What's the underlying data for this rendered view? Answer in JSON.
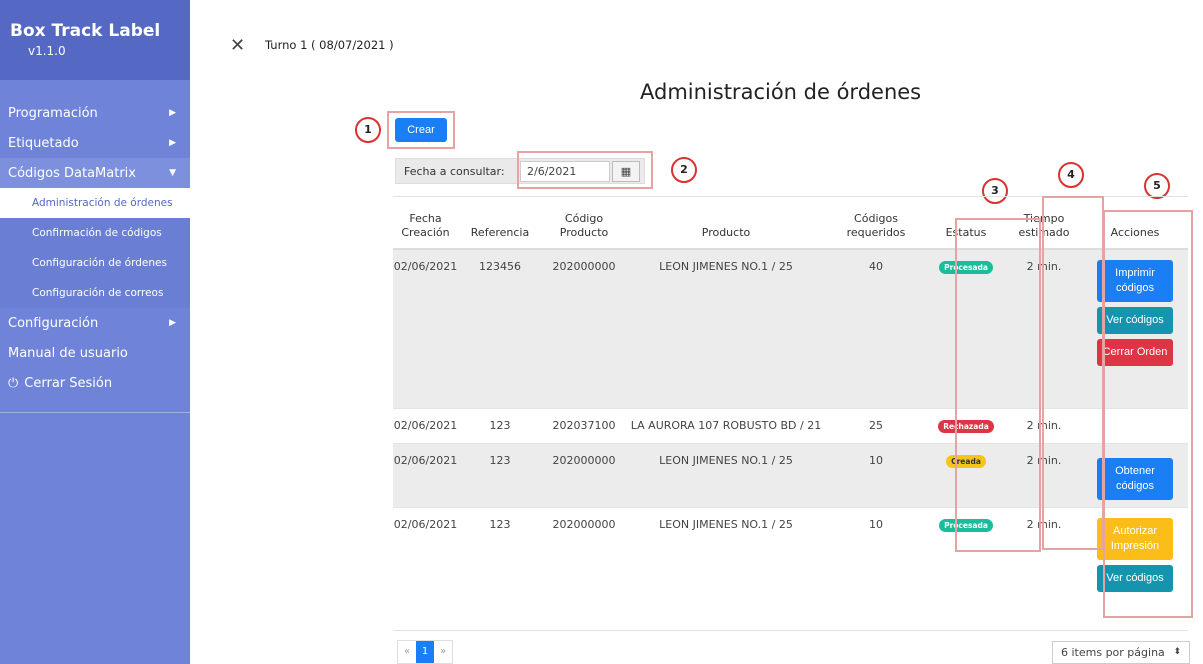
{
  "sidebar": {
    "title": "Box Track Label",
    "version": "v1.1.0",
    "items": [
      {
        "label": "Programación"
      },
      {
        "label": "Etiquetado"
      },
      {
        "label": "Códigos DataMatrix"
      },
      {
        "label": "Configuración"
      },
      {
        "label": "Manual de usuario"
      },
      {
        "label": "Cerrar Sesión"
      }
    ],
    "subitems": [
      {
        "label": "Administración de órdenes"
      },
      {
        "label": "Confirmación de códigos"
      },
      {
        "label": "Configuración de órdenes"
      },
      {
        "label": "Configuración de correos"
      }
    ]
  },
  "topbar": {
    "shift": "Turno 1 ( 08/07/2021 )"
  },
  "page": {
    "title": "Administración de órdenes",
    "create_label": "Crear"
  },
  "filter": {
    "label": "Fecha a consultar:",
    "value": "2/6/2021"
  },
  "annotations": [
    "1",
    "2",
    "3",
    "4",
    "5"
  ],
  "table": {
    "headers": {
      "fecha": "Fecha Creación",
      "referencia": "Referencia",
      "codigo": "Código Producto",
      "producto": "Producto",
      "codigos_req": "Códigos requeridos",
      "estatus": "Estatus",
      "tiempo": "Tiempo estimado",
      "acciones": "Acciones"
    },
    "rows": [
      {
        "fecha": "02/06/2021",
        "referencia": "123456",
        "codigo": "202000000",
        "producto": "LEON JIMENES NO.1 / 25",
        "cantidad": "40",
        "estatus": "Procesada",
        "tiempo": "2 min.",
        "actions": [
          "Imprimir códigos",
          "Ver códigos",
          "Cerrar Orden"
        ]
      },
      {
        "fecha": "02/06/2021",
        "referencia": "123",
        "codigo": "202037100",
        "producto": "LA AURORA 107 ROBUSTO BD / 21",
        "cantidad": "25",
        "estatus": "Rechazada",
        "tiempo": "2 min.",
        "actions": []
      },
      {
        "fecha": "02/06/2021",
        "referencia": "123",
        "codigo": "202000000",
        "producto": "LEON JIMENES NO.1 / 25",
        "cantidad": "10",
        "estatus": "Creada",
        "tiempo": "2 min.",
        "actions": [
          "Obtener códigos"
        ]
      },
      {
        "fecha": "02/06/2021",
        "referencia": "123",
        "codigo": "202000000",
        "producto": "LEON JIMENES NO.1 / 25",
        "cantidad": "10",
        "estatus": "Procesada",
        "tiempo": "2 min.",
        "actions": [
          "Autorizar Impresión",
          "Ver códigos"
        ]
      }
    ]
  },
  "pagination": {
    "prev": "«",
    "current": "1",
    "next": "»",
    "per_page": "6 items por página"
  },
  "colors": {
    "sidebar": "#6f84d8",
    "sidebar_header": "#5468c4",
    "primary": "#1a7ff5",
    "teal": "#1595ad",
    "danger": "#dc3545",
    "warning": "#fbbe19",
    "success": "#1bbc9c",
    "highlight": "#e6a3a3"
  }
}
